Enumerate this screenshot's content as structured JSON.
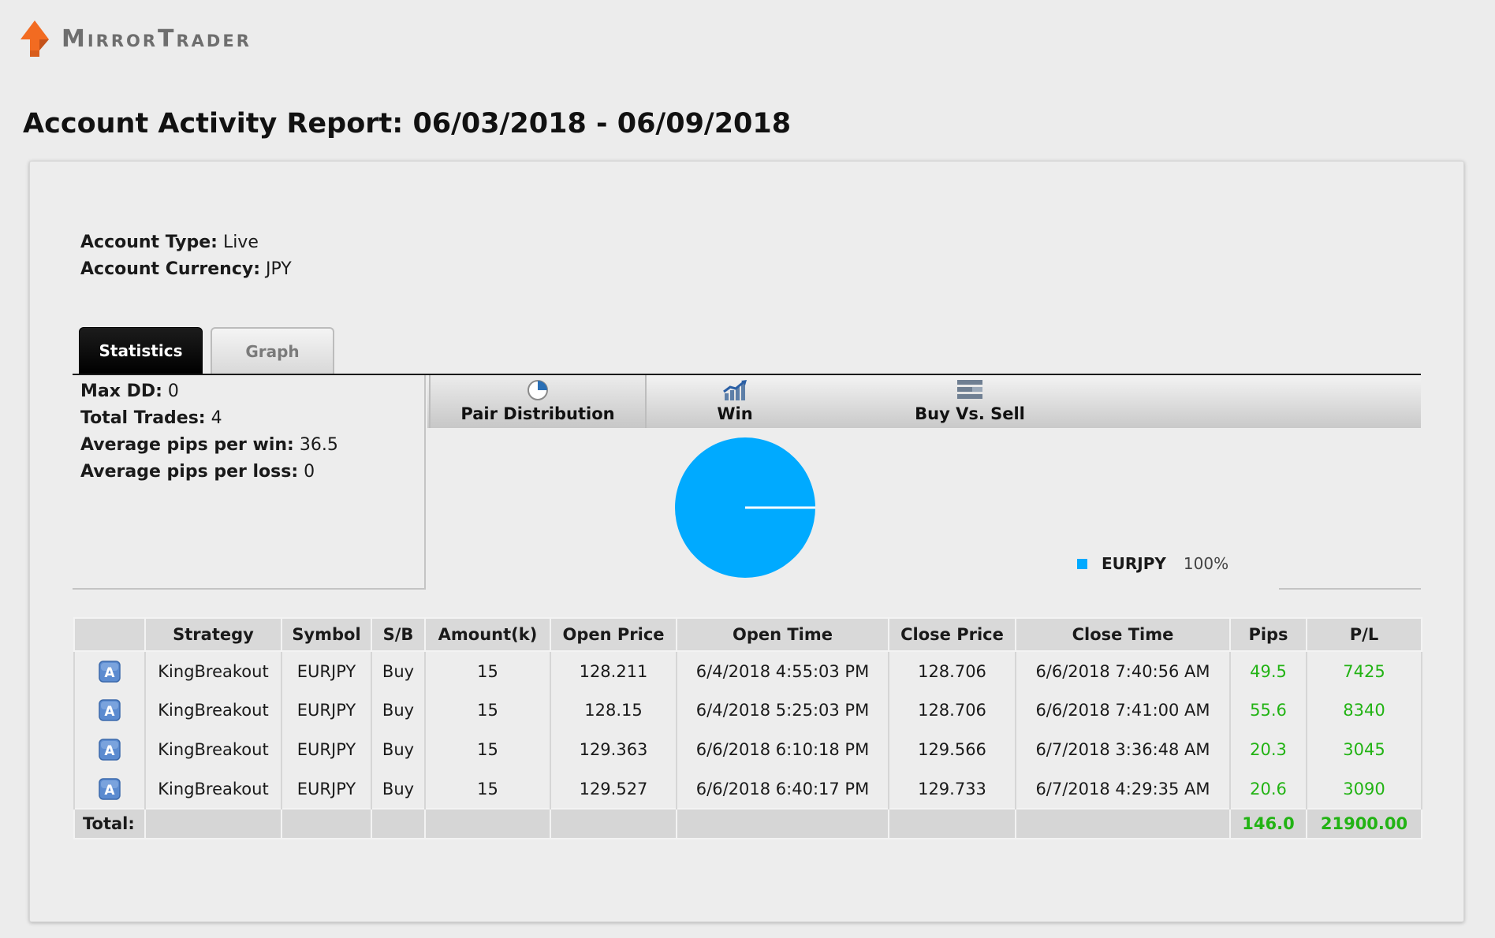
{
  "brand": {
    "name": "MirrorTrader",
    "accent": "#f26b21"
  },
  "report": {
    "title": "Account Activity Report: 06/03/2018 - 06/09/2018"
  },
  "account": {
    "type_label": "Account Type:",
    "type_value": "Live",
    "currency_label": "Account Currency:",
    "currency_value": "JPY"
  },
  "tabs": [
    {
      "label": "Statistics",
      "active": true
    },
    {
      "label": "Graph",
      "active": false
    }
  ],
  "stats": [
    {
      "label": "Max DD:",
      "value": "0"
    },
    {
      "label": "Total Trades:",
      "value": "4"
    },
    {
      "label": "Average pips per win:",
      "value": "36.5"
    },
    {
      "label": "Average pips per loss:",
      "value": "0"
    }
  ],
  "chart_tabs": [
    {
      "label": "Pair Distribution",
      "icon": "pie-chart-icon",
      "active": true
    },
    {
      "label": "Win",
      "icon": "bar-trend-icon",
      "active": false
    },
    {
      "label": "Buy Vs. Sell",
      "icon": "stacked-bars-icon",
      "active": false
    }
  ],
  "chart_data": {
    "type": "pie",
    "slices": [
      {
        "label": "EURJPY",
        "value": 100,
        "display": "100%",
        "color": "#00aaff"
      }
    ],
    "legend_position": "bottom-right"
  },
  "table": {
    "headers": [
      "",
      "Strategy",
      "Symbol",
      "S/B",
      "Amount(k)",
      "Open Price",
      "Open Time",
      "Close Price",
      "Close Time",
      "Pips",
      "P/L"
    ],
    "rows": [
      {
        "icon": "A",
        "strategy": "KingBreakout",
        "symbol": "EURJPY",
        "side": "Buy",
        "amount": "15",
        "open_price": "128.211",
        "open_time": "6/4/2018 4:55:03 PM",
        "close_price": "128.706",
        "close_time": "6/6/2018 7:40:56 AM",
        "pips": "49.5",
        "pl": "7425"
      },
      {
        "icon": "A",
        "strategy": "KingBreakout",
        "symbol": "EURJPY",
        "side": "Buy",
        "amount": "15",
        "open_price": "128.15",
        "open_time": "6/4/2018 5:25:03 PM",
        "close_price": "128.706",
        "close_time": "6/6/2018 7:41:00 AM",
        "pips": "55.6",
        "pl": "8340"
      },
      {
        "icon": "A",
        "strategy": "KingBreakout",
        "symbol": "EURJPY",
        "side": "Buy",
        "amount": "15",
        "open_price": "129.363",
        "open_time": "6/6/2018 6:10:18 PM",
        "close_price": "129.566",
        "close_time": "6/7/2018 3:36:48 AM",
        "pips": "20.3",
        "pl": "3045"
      },
      {
        "icon": "A",
        "strategy": "KingBreakout",
        "symbol": "EURJPY",
        "side": "Buy",
        "amount": "15",
        "open_price": "129.527",
        "open_time": "6/6/2018 6:40:17 PM",
        "close_price": "129.733",
        "close_time": "6/7/2018 4:29:35 AM",
        "pips": "20.6",
        "pl": "3090"
      }
    ],
    "total": {
      "label": "Total:",
      "pips": "146.0",
      "pl": "21900.00"
    }
  },
  "colors": {
    "positive": "#22b314",
    "pie": "#00aaff",
    "tab_active_bg": "#000000"
  }
}
